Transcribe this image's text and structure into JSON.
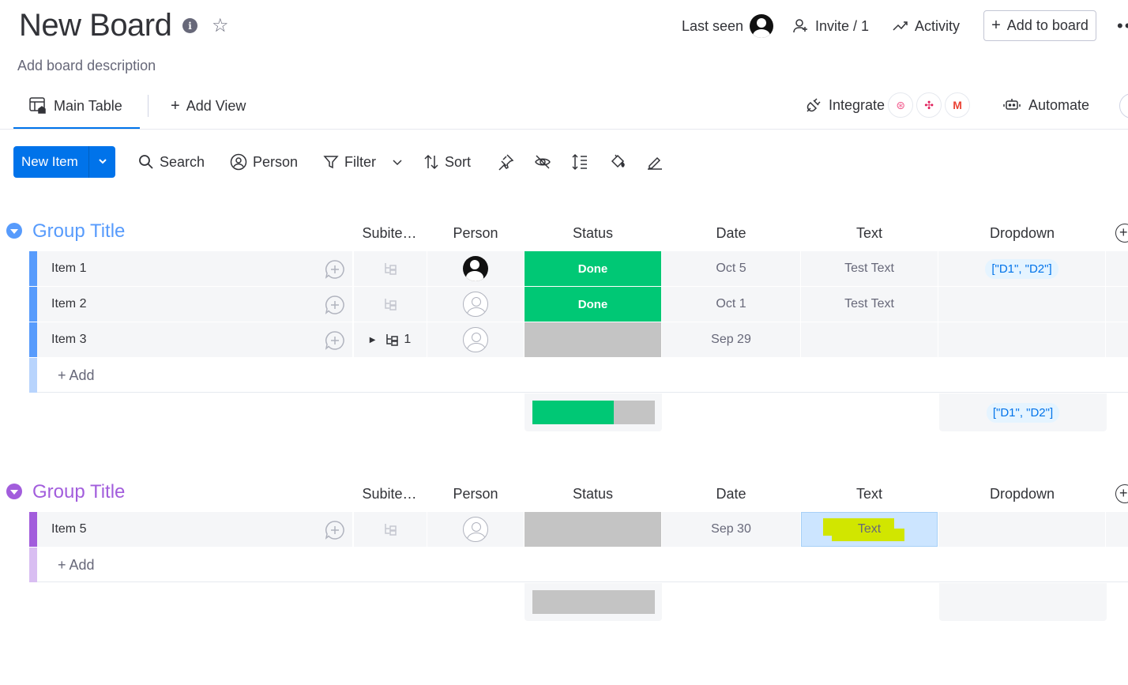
{
  "board": {
    "title": "New Board",
    "description": "Add board description"
  },
  "header": {
    "last_seen": "Last seen",
    "invite": "Invite / 1",
    "activity": "Activity",
    "add_to_board": "Add to board",
    "more": "••"
  },
  "views": {
    "main_table": "Main Table",
    "add_view": "Add View",
    "integrate": "Integrate",
    "automate": "Automate"
  },
  "toolbar": {
    "new_item": "New Item",
    "search": "Search",
    "person": "Person",
    "filter": "Filter",
    "sort": "Sort"
  },
  "columns": {
    "subitems": "Subite…",
    "person": "Person",
    "status": "Status",
    "date": "Date",
    "text": "Text",
    "dropdown": "Dropdown"
  },
  "groups": [
    {
      "title": "Group Title",
      "color": "#579bfc",
      "light_color": "#b8d4fd",
      "add_label": "+ Add",
      "rows": [
        {
          "name": "Item 1",
          "status": "Done",
          "date": "Oct 5",
          "text": "Test Text",
          "dropdown": "[\"D1\", \"D2\"]",
          "subitems": ""
        },
        {
          "name": "Item 2",
          "status": "Done",
          "date": "Oct 1",
          "text": "Test Text",
          "dropdown": "",
          "subitems": ""
        },
        {
          "name": "Item 3",
          "status": "",
          "date": "Sep 29",
          "text": "",
          "dropdown": "",
          "subitems": "1"
        }
      ],
      "summary": {
        "status_done_fraction": 0.667,
        "dropdown": "[\"D1\", \"D2\"]"
      }
    },
    {
      "title": "Group Title",
      "color": "#a25ddc",
      "light_color": "#d9bef2",
      "add_label": "+ Add",
      "rows": [
        {
          "name": "Item 5",
          "status": "",
          "date": "Sep 30",
          "text": "Text",
          "dropdown": "",
          "subitems": ""
        }
      ],
      "summary": {
        "status_done_fraction": 0
      }
    }
  ],
  "colors": {
    "primary": "#0073ea",
    "done": "#00c875",
    "empty_status": "#c4c4c4",
    "highlight": "#d1e600"
  }
}
